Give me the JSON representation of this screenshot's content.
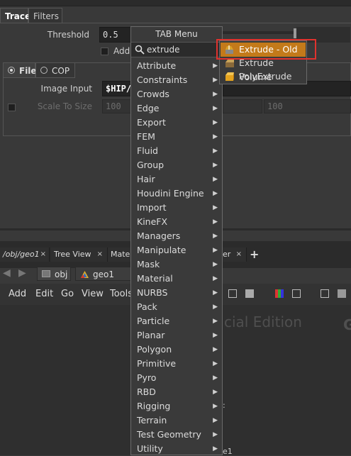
{
  "params_panel": {
    "tabs": [
      "Trace",
      "Filters"
    ],
    "threshold_label": "Threshold",
    "threshold_value": "0.5",
    "add_label": "Add",
    "source_tabs": [
      "File",
      "COP"
    ],
    "image_input_label": "Image Input",
    "image_input_value": "$HIP/",
    "scale_label": "Scale To Size",
    "scale_values": [
      "100",
      "100",
      "100"
    ]
  },
  "network_pane": {
    "pane_tabs": [
      "/obj/geo1",
      "Tree View",
      "Materi",
      "er"
    ],
    "close_glyph": "×",
    "add_tab": "+",
    "path": [
      "obj",
      "geo1"
    ],
    "menu_bar": [
      "Add",
      "Edit",
      "Go",
      "View",
      "Tools"
    ],
    "watermark": "cial Edition",
    "watermark_letter": "G",
    "bottom_fragment_a": ":",
    "bottom_fragment_b": "e1"
  },
  "tab_menu": {
    "title": "TAB Menu",
    "search_value": "extrude",
    "items": [
      {
        "label": "Attribute",
        "arrow": "▶"
      },
      {
        "label": "Constraints",
        "arrow": "▶"
      },
      {
        "label": "Crowds",
        "arrow": "▶"
      },
      {
        "label": "Edge",
        "arrow": "▶"
      },
      {
        "label": "Export",
        "arrow": "▶"
      },
      {
        "label": "FEM",
        "arrow": "▶"
      },
      {
        "label": "Fluid",
        "arrow": "▶"
      },
      {
        "label": "Group",
        "arrow": "▶"
      },
      {
        "label": "Hair",
        "arrow": "▶"
      },
      {
        "label": "Houdini Engine",
        "arrow": "▶"
      },
      {
        "label": "Import",
        "arrow": "▶"
      },
      {
        "label": "KineFX",
        "arrow": "▶"
      },
      {
        "label": "Managers",
        "arrow": "▶"
      },
      {
        "label": "Manipulate",
        "arrow": "▶"
      },
      {
        "label": "Mask",
        "arrow": "▶"
      },
      {
        "label": "Material",
        "arrow": "▶"
      },
      {
        "label": "NURBS",
        "arrow": "▶"
      },
      {
        "label": "Pack",
        "arrow": "▶"
      },
      {
        "label": "Particle",
        "arrow": "▶"
      },
      {
        "label": "Planar",
        "arrow": "▶"
      },
      {
        "label": "Polygon",
        "arrow": "▶"
      },
      {
        "label": "Primitive",
        "arrow": "▶"
      },
      {
        "label": "Pyro",
        "arrow": "▶"
      },
      {
        "label": "RBD",
        "arrow": "▶"
      },
      {
        "label": "Rigging",
        "arrow": "▶"
      },
      {
        "label": "Terrain",
        "arrow": "▶"
      },
      {
        "label": "Test Geometry",
        "arrow": "▶"
      },
      {
        "label": "Utility",
        "arrow": "▶"
      }
    ],
    "results": [
      {
        "label": "Extrude - Old",
        "selected": true
      },
      {
        "label": "Extrude Volume",
        "selected": false
      },
      {
        "label": "PolyExtrude",
        "selected": false
      }
    ]
  },
  "colors": {
    "selection": "#c37a1a",
    "highlight_box": "#e0322e",
    "background": "#393939"
  }
}
